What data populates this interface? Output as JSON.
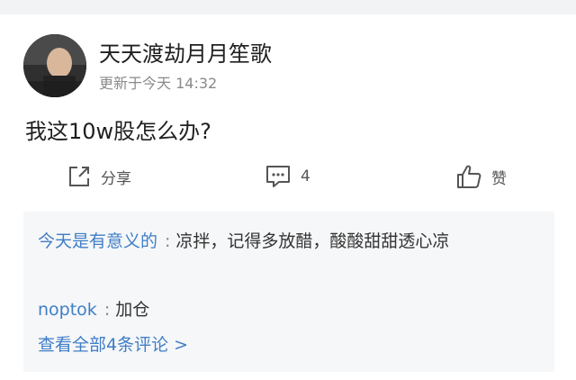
{
  "post": {
    "username": "天天渡劫月月笙歌",
    "updated": "更新于今天 14:32",
    "text": "我这10w股怎么办?"
  },
  "actions": {
    "share_label": "分享",
    "comment_count": "4",
    "like_label": "赞"
  },
  "comments": [
    {
      "author": "今天是有意义的",
      "separator": ":",
      "text": "凉拌，记得多放醋，酸酸甜甜透心凉"
    },
    {
      "author": "noptok",
      "separator": ":",
      "text": "加仓"
    }
  ],
  "view_all": "查看全部4条评论 >",
  "colors": {
    "link": "#3f7ec7",
    "comment_bg": "#f6f7f9",
    "muted": "#8a8a8a"
  }
}
